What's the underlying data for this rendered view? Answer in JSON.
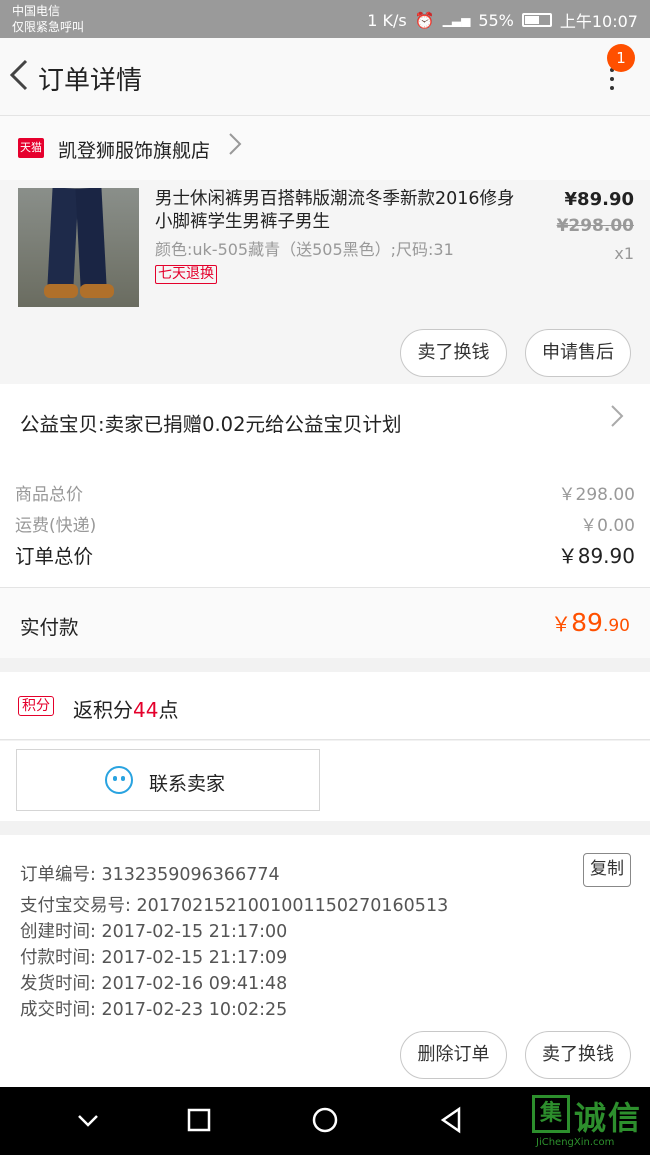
{
  "status": {
    "carrier_line1": "中国电信",
    "carrier_line2": "仅限紧急呼叫",
    "speed": "1 K/s",
    "battery": "55%",
    "time": "上午10:07"
  },
  "header": {
    "title": "订单详情",
    "notification_count": "1"
  },
  "shop": {
    "badge": "天猫",
    "name": "凯登狮服饰旗舰店"
  },
  "product": {
    "title": "男士休闲裤男百搭韩版潮流冬季新款2016修身小脚裤学生男裤子男生",
    "sku": "颜色:uk-505藏青（送505黑色）;尺码:31",
    "tag": "七天退换",
    "price": "¥89.90",
    "original_price": "¥298.00",
    "quantity": "x1",
    "buttons": {
      "sell": "卖了换钱",
      "after_sale": "申请售后"
    }
  },
  "charity": {
    "text": "公益宝贝:卖家已捐赠0.02元给公益宝贝计划"
  },
  "summary": {
    "goods_total_label": "商品总价",
    "goods_total_value": "￥298.00",
    "shipping_label": "运费(快递)",
    "shipping_value": "￥0.00",
    "order_total_label": "订单总价",
    "order_total_value": "￥89.90"
  },
  "paid": {
    "label": "实付款",
    "currency": "￥",
    "integer": "89",
    "decimal": ".90"
  },
  "points": {
    "badge": "积分",
    "prefix": "返积分",
    "count": "44",
    "suffix": "点"
  },
  "contact": {
    "label": "联系卖家"
  },
  "order_info": {
    "order_no": "订单编号: 3132359096366774",
    "alipay_no": "支付宝交易号: 2017021521001001150270160513",
    "created": "创建时间: 2017-02-15 21:17:00",
    "paid": "付款时间: 2017-02-15 21:17:09",
    "shipped": "发货时间: 2017-02-16 09:41:48",
    "completed": "成交时间: 2017-02-23 10:02:25",
    "copy": "复制",
    "buttons": {
      "delete": "删除订单",
      "sell": "卖了换钱"
    }
  },
  "watermark": {
    "logo": "集",
    "text": "诚信",
    "url": "JiChengXin.com"
  },
  "colors": {
    "accent": "#ff5000",
    "tmall_red": "#e4002b",
    "contact_blue": "#29a3e0"
  }
}
